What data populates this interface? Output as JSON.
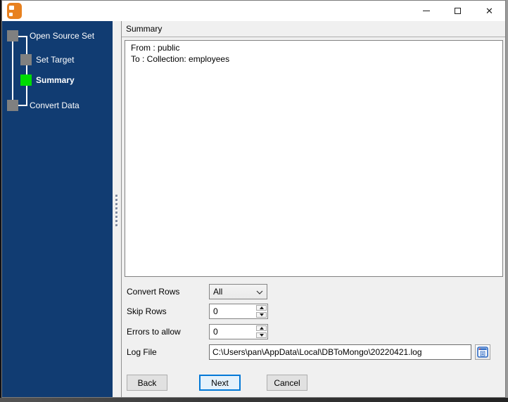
{
  "titlebar": {
    "close_glyph": "✕",
    "app_icon_color": "#E8811F"
  },
  "sidebar": {
    "background_color": "#113C72",
    "current_step_color": "#00DC00",
    "step_marker_color": "#808080",
    "steps": [
      {
        "label": "Open Source Set",
        "status": "visited"
      },
      {
        "label": "Set Target",
        "status": "visited"
      },
      {
        "label": "Summary",
        "status": "current"
      },
      {
        "label": "Convert Data",
        "status": "upcoming"
      }
    ]
  },
  "main": {
    "group_title": "Summary",
    "summary_lines": [
      "From : public",
      "To : Collection: employees"
    ],
    "fields": {
      "convert_rows": {
        "label": "Convert Rows",
        "type": "dropdown",
        "value": "All"
      },
      "skip_rows": {
        "label": "Skip Rows",
        "type": "spinner",
        "value": "0"
      },
      "errors_to_allow": {
        "label": "Errors to allow",
        "type": "spinner",
        "value": "0"
      },
      "log_file": {
        "label": "Log File",
        "type": "text",
        "value": "C:\\Users\\pan\\AppData\\Local\\DBToMongo\\20220421.log"
      }
    },
    "buttons": {
      "back": "Back",
      "next": "Next",
      "cancel": "Cancel"
    },
    "accent_color": "#0078D7"
  }
}
